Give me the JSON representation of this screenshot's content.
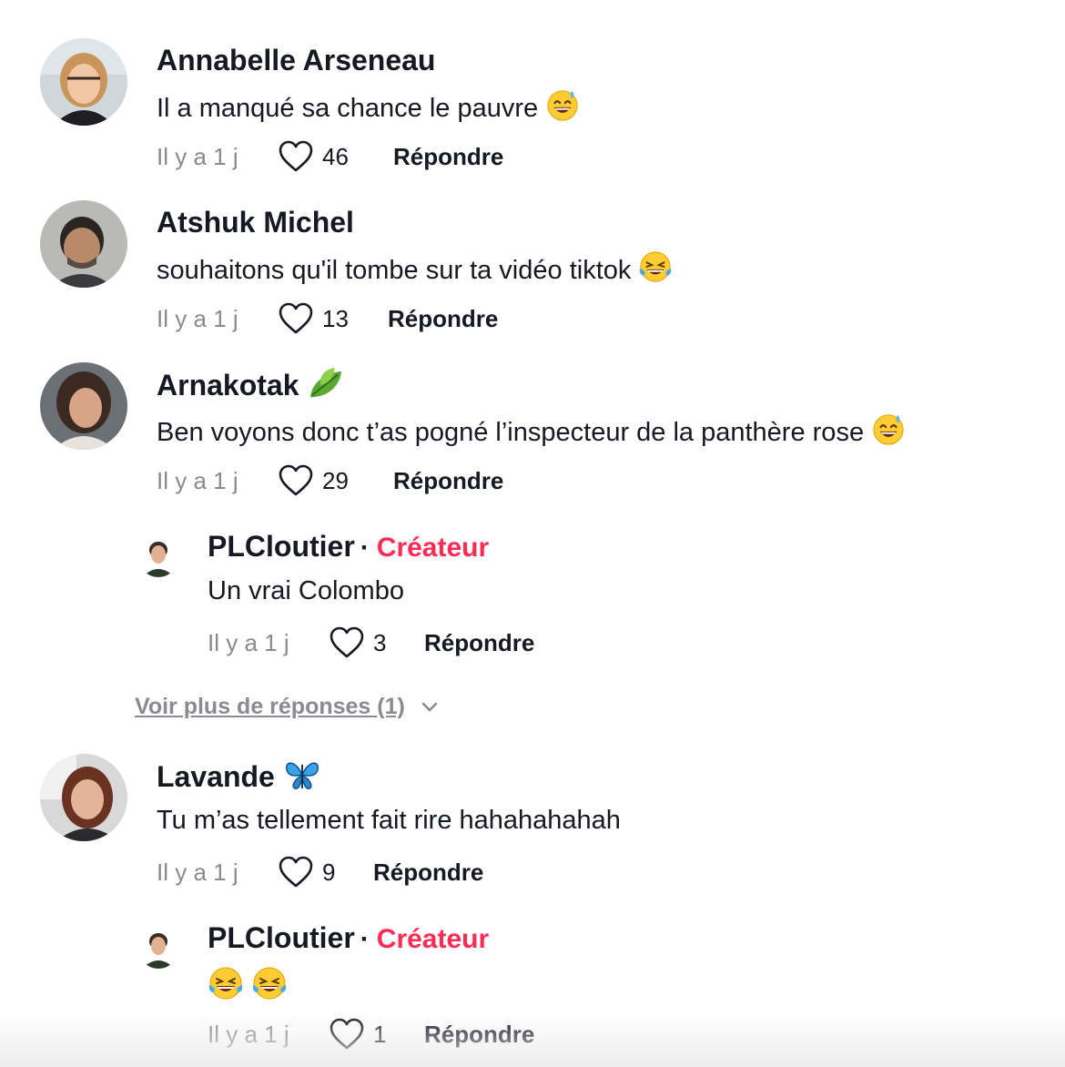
{
  "comments": [
    {
      "username": "Annabelle Arseneau",
      "text": "Il a manqué sa chance le pauvre",
      "timestamp": "Il y a 1 j",
      "likes": "46",
      "reply_label": "Répondre",
      "text_emoji": "sweat-smile-emoji"
    },
    {
      "username": "Atshuk Michel",
      "text": "souhaitons qu'il tombe sur ta vidéo tiktok",
      "timestamp": "Il y a 1 j",
      "likes": "13",
      "reply_label": "Répondre",
      "text_emoji": "tears-of-joy-emoji"
    },
    {
      "username": "Arnakotak",
      "username_emoji": "leaf-emoji",
      "text": "Ben voyons donc t’as pogné l’inspecteur de la panthère rose",
      "timestamp": "Il y a 1 j",
      "likes": "29",
      "reply_label": "Répondre",
      "text_emoji": "sweat-smile-emoji",
      "reply": {
        "username": "PLCloutier",
        "separator": "·",
        "badge": "Créateur",
        "text": "Un vrai Colombo",
        "timestamp": "Il y a 1 j",
        "likes": "3",
        "reply_label": "Répondre"
      },
      "more_replies": "Voir plus de réponses (1)"
    },
    {
      "username": "Lavande",
      "username_emoji": "butterfly-emoji",
      "text": "Tu m’as tellement fait rire hahahahahah",
      "timestamp": "Il y a 1 j",
      "likes": "9",
      "reply_label": "Répondre",
      "reply": {
        "username": "PLCloutier",
        "separator": "·",
        "badge": "Créateur",
        "text_emojis": [
          "tears-of-joy-emoji",
          "tears-of-joy-emoji"
        ],
        "timestamp": "Il y a 1 j",
        "likes": "1",
        "reply_label": "Répondre"
      }
    }
  ],
  "colors": {
    "text": "#161823",
    "muted": "#8a8b91",
    "creator_badge": "#fe2c55"
  }
}
